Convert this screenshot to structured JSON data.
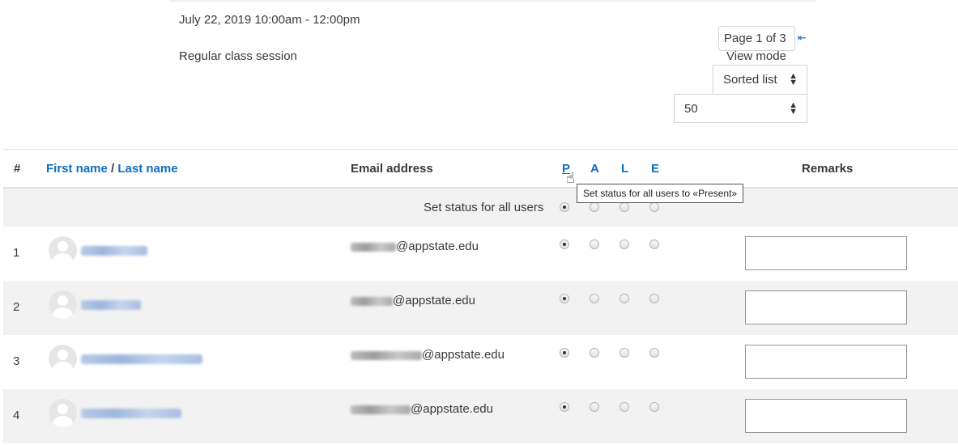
{
  "session": {
    "date": "July 22, 2019 10:00am - 12:00pm",
    "description": "Regular class session"
  },
  "pagination": {
    "page_select": "Page 1 of 3",
    "arrow": "⇤"
  },
  "view_mode": {
    "label": "View mode",
    "selected": "Sorted list"
  },
  "per_page": {
    "selected": "50"
  },
  "table": {
    "headers": {
      "num": "#",
      "first_name": "First name",
      "separator": " / ",
      "last_name": "Last name",
      "email": "Email address",
      "status": [
        "P",
        "A",
        "L",
        "E"
      ],
      "remarks": "Remarks"
    },
    "set_all_label": "Set status for all users",
    "tooltip": "Set status for all users to «Present»",
    "rows": [
      {
        "num": "1",
        "email_domain": "@appstate.edu",
        "status_selected": "P"
      },
      {
        "num": "2",
        "email_domain": "@appstate.edu",
        "status_selected": "P"
      },
      {
        "num": "3",
        "email_domain": "@appstate.edu",
        "status_selected": "P"
      },
      {
        "num": "4",
        "email_domain": "@appstate.edu",
        "status_selected": "P"
      }
    ]
  },
  "colors": {
    "link": "#0f6cbf",
    "row_alt": "#f2f2f2",
    "border": "#dee2e6"
  },
  "icons": {
    "avatar": "user-avatar-icon",
    "select_caret": "updown-caret-icon",
    "cursor": "hand-pointer-icon"
  }
}
